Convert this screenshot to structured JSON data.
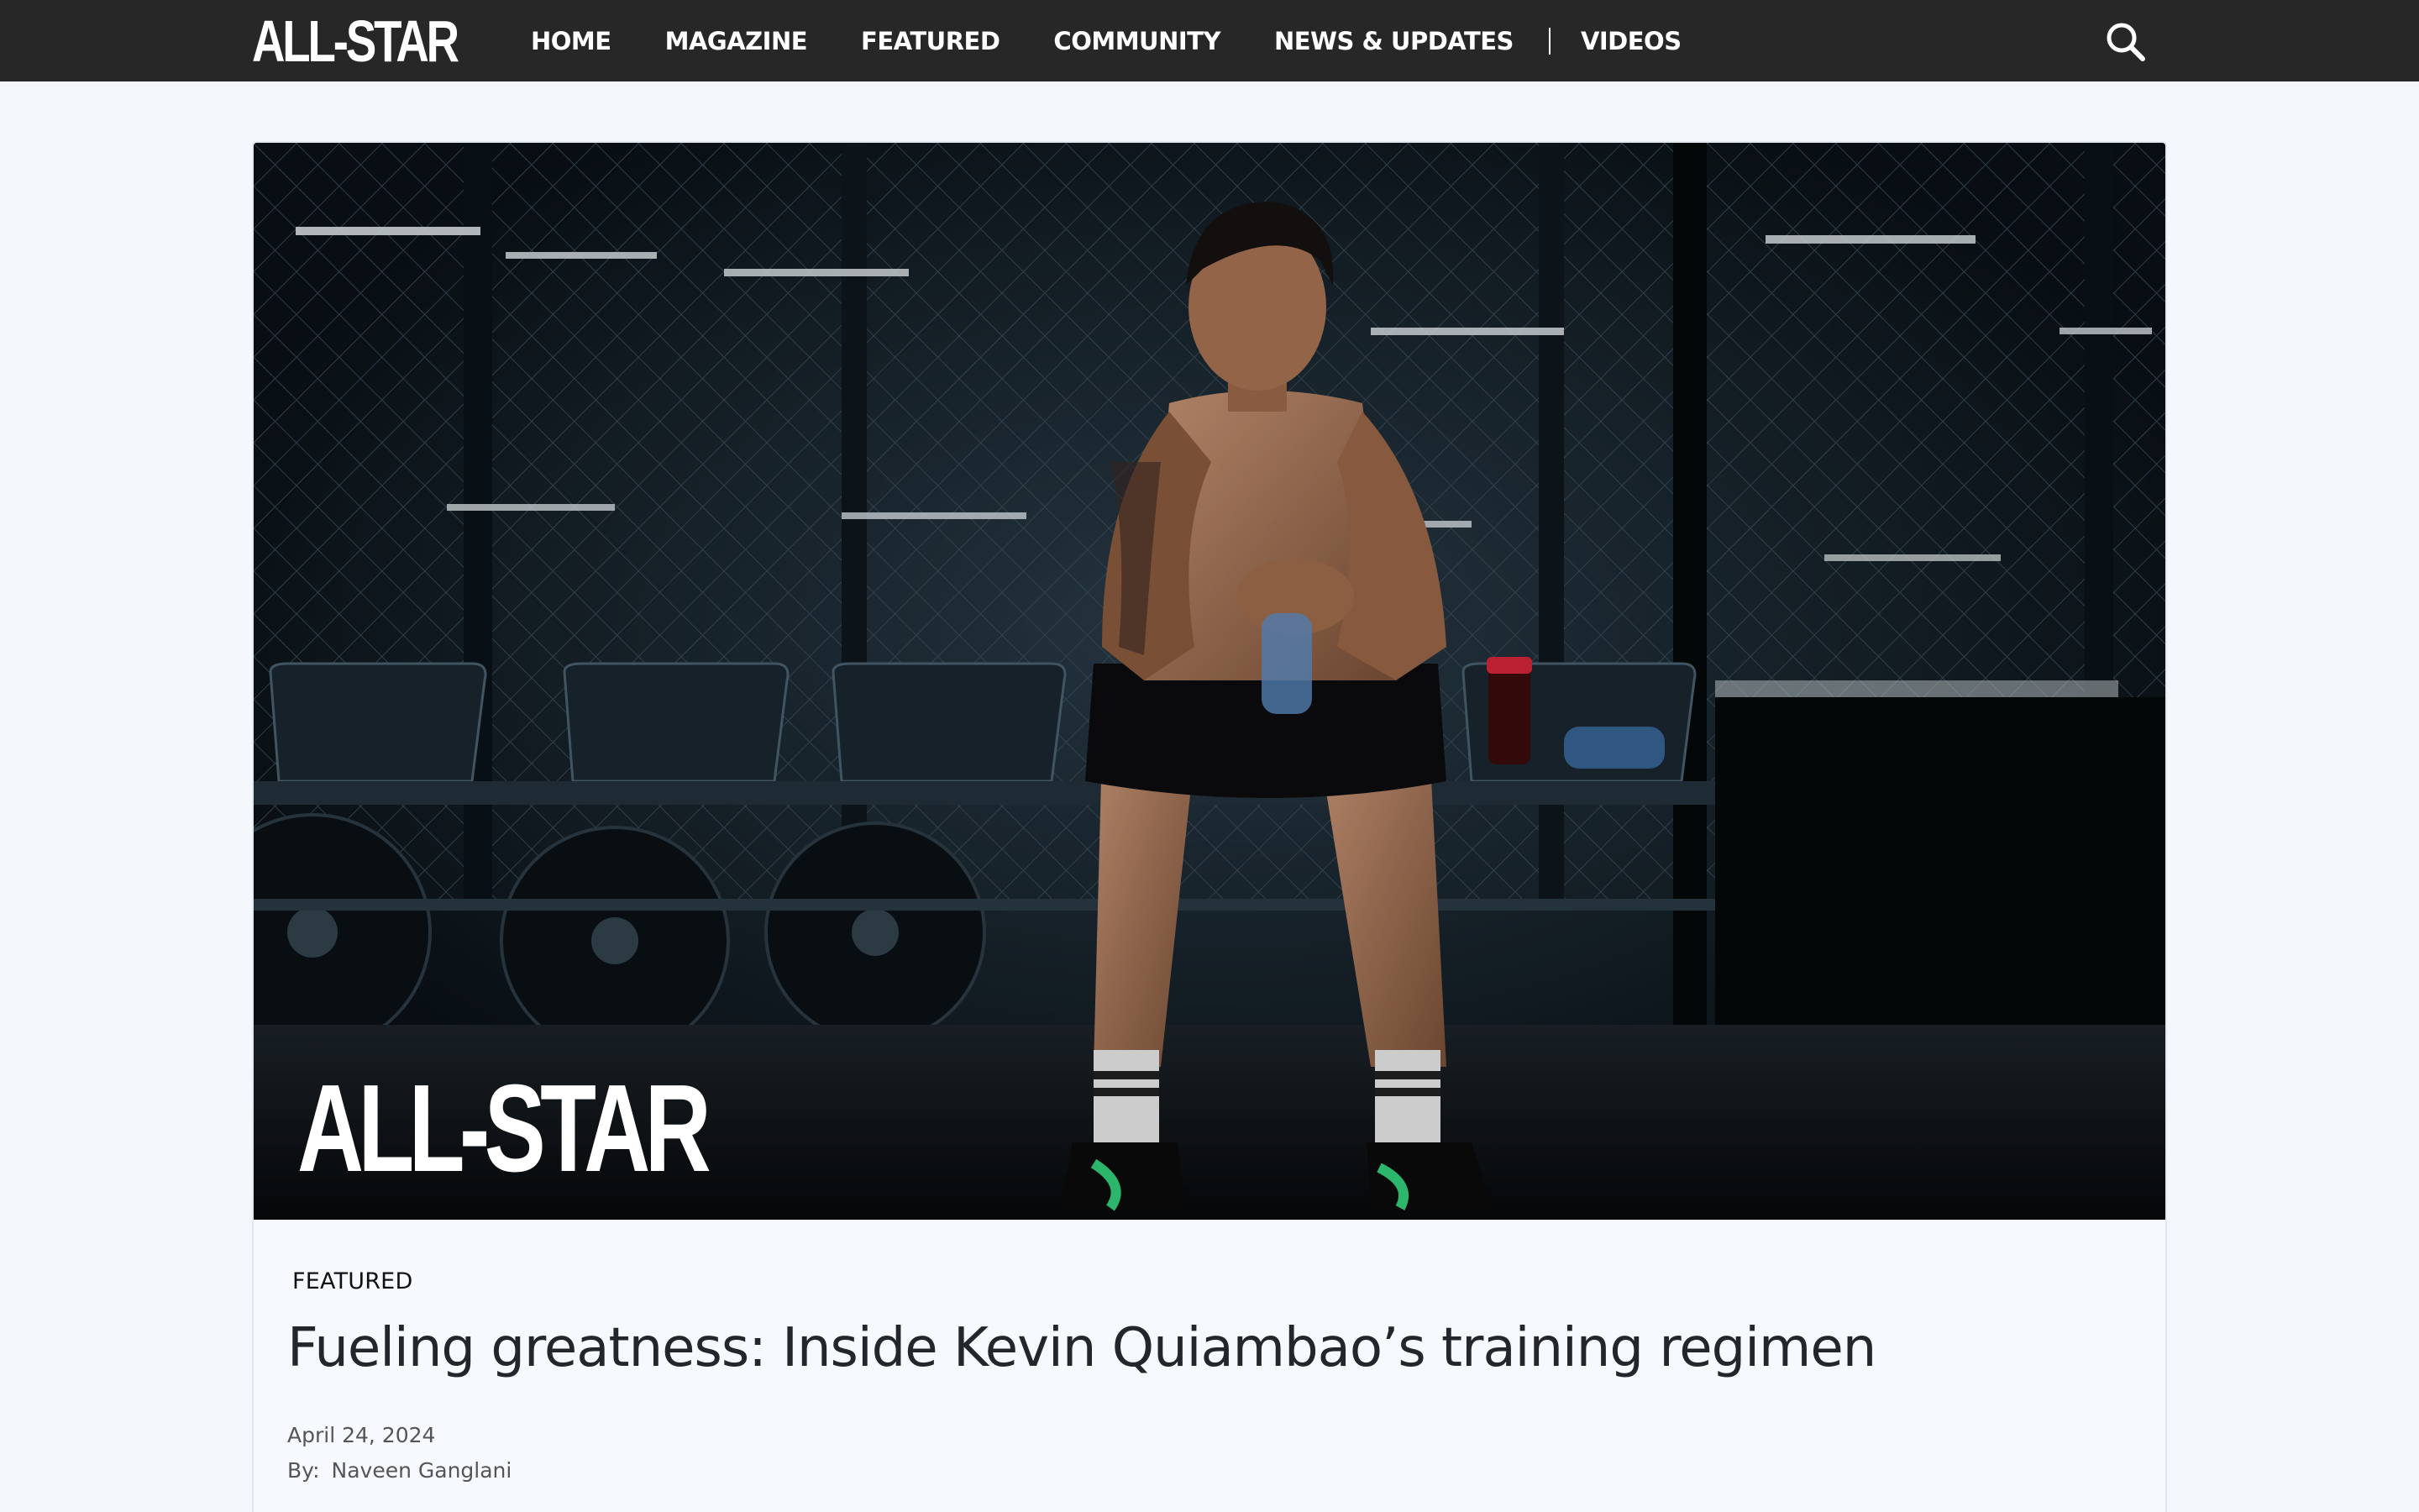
{
  "brand": {
    "logo_text": "ALL-STAR"
  },
  "nav": {
    "items": [
      {
        "label": "HOME"
      },
      {
        "label": "MAGAZINE"
      },
      {
        "label": "FEATURED"
      },
      {
        "label": "COMMUNITY"
      },
      {
        "label": "NEWS & UPDATES"
      },
      {
        "label": "VIDEOS"
      }
    ],
    "search_icon": "search-icon"
  },
  "article": {
    "hero_image": {
      "description_icon": "hero-photo",
      "watermark": "ALL-STAR"
    },
    "category": "FEATURED",
    "title": "Fueling greatness: Inside Kevin Quiambao’s training regimen",
    "date": "April 24, 2024",
    "author_prefix": "By:",
    "author": "Naveen Ganglani"
  },
  "colors": {
    "navbar_bg": "#272727",
    "page_bg": "#f4f7fc",
    "text_primary": "#23262b",
    "text_muted": "#555555"
  }
}
